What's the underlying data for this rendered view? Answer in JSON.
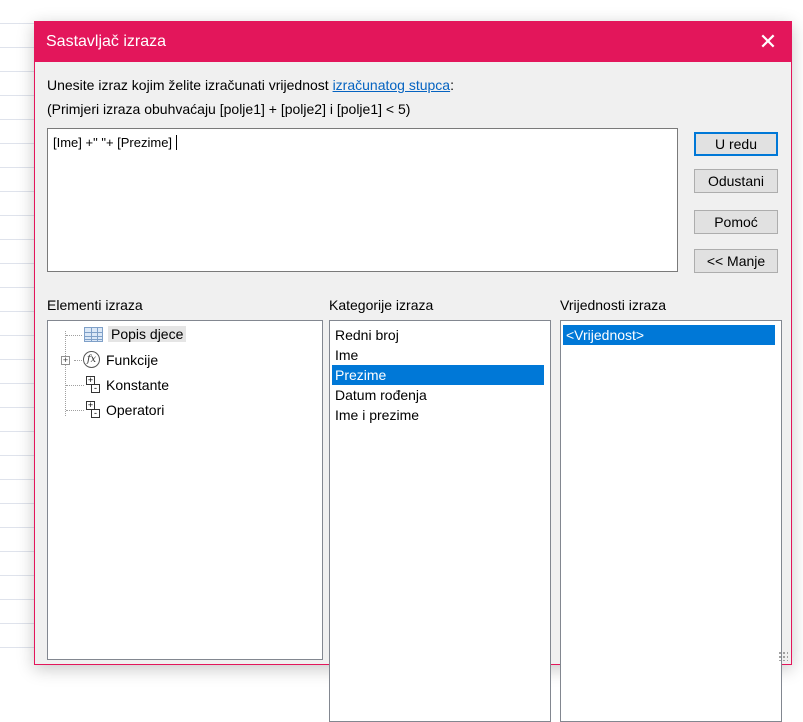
{
  "dialog": {
    "title": "Sastavljač izraza",
    "close_glyph": "✕",
    "instruction_prefix": "Unesite izraz kojim želite izračunati vrijednost ",
    "instruction_link": "izračunatog stupca",
    "instruction_suffix": ":",
    "examples": "(Primjeri izraza obuhvaćaju [polje1] + [polje2] i [polje1] < 5)",
    "expression_value": "[Ime] +\" \"+ [Prezime]"
  },
  "buttons": {
    "ok": "U redu",
    "cancel": "Odustani",
    "help": "Pomoć",
    "less": "<< Manje"
  },
  "panels": {
    "elements_label": "Elementi izraza",
    "categories_label": "Kategorije izraza",
    "values_label": "Vrijednosti izraza"
  },
  "elements": [
    {
      "label": "Popis djece",
      "icon": "table-icon"
    },
    {
      "label": "Funkcije",
      "icon": "function-icon"
    },
    {
      "label": "Konstante",
      "icon": "constants-icon"
    },
    {
      "label": "Operatori",
      "icon": "operators-icon"
    }
  ],
  "categories": [
    "Redni broj",
    "Ime",
    "Prezime",
    "Datum rođenja",
    "Ime i prezime"
  ],
  "selected_category": "Prezime",
  "values": [
    "<Vrijednost>"
  ],
  "colors": {
    "titlebar": "#e3165b",
    "selection": "#0078d7",
    "link": "#0563c1"
  }
}
